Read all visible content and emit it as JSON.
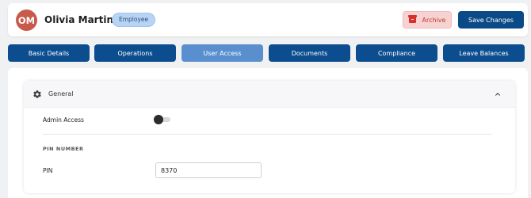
{
  "header": {
    "avatar_initials": "OM",
    "employee_name": "Olivia Martin",
    "role_badge": "Employee",
    "archive_label": "Archive",
    "save_label": "Save Changes"
  },
  "tabs": [
    {
      "label": "Basic Details",
      "active": false
    },
    {
      "label": "Operations",
      "active": false
    },
    {
      "label": "User Access",
      "active": true
    },
    {
      "label": "Documents",
      "active": false
    },
    {
      "label": "Compliance",
      "active": false
    },
    {
      "label": "Leave Balances",
      "active": false
    }
  ],
  "section": {
    "title": "General",
    "icon": "gear-icon",
    "expanded": true,
    "admin_access_label": "Admin Access",
    "admin_access_enabled": false,
    "pin_section_title": "PIN NUMBER",
    "pin_label": "PIN",
    "pin_value": "8370"
  },
  "colors": {
    "primary": "#0b4d8e",
    "active_tab": "#5a8fcf",
    "archive_bg": "#f6d3d2",
    "archive_accent": "#d9302b",
    "avatar_bg": "#c85a4a",
    "badge_bg": "#b8d4f4"
  }
}
